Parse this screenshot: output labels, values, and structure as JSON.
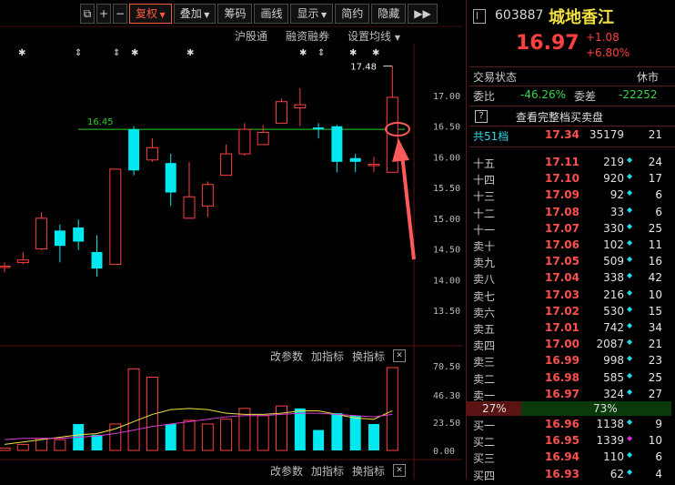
{
  "toolbar": {
    "buttons": [
      {
        "label": "⧉",
        "active": false,
        "square": true,
        "name": "window-toggle-button"
      },
      {
        "label": "+",
        "active": false,
        "square": true,
        "name": "zoom-in-button"
      },
      {
        "label": "−",
        "active": false,
        "square": true,
        "name": "zoom-out-button"
      },
      {
        "label": "复权",
        "active": true,
        "arrow": true,
        "name": "adjust-dropdown"
      },
      {
        "label": "叠加",
        "active": false,
        "arrow": true,
        "name": "overlay-dropdown"
      },
      {
        "label": "筹码",
        "active": false,
        "name": "chips-button"
      },
      {
        "label": "画线",
        "active": false,
        "name": "draw-line-button"
      },
      {
        "label": "显示",
        "active": false,
        "arrow": true,
        "name": "display-dropdown"
      },
      {
        "label": "简约",
        "active": false,
        "name": "simple-button"
      },
      {
        "label": "隐藏",
        "active": false,
        "name": "hide-button"
      },
      {
        "label": "▶▶",
        "active": false,
        "name": "more-button"
      }
    ],
    "sub": {
      "hugutong": "沪股通",
      "rongzi": "融资融券",
      "settings": "设置均线"
    }
  },
  "price_chart": {
    "axis_labels": [
      "17.00",
      "16.50",
      "16.00",
      "15.50",
      "15.00",
      "14.50",
      "14.00",
      "13.50"
    ],
    "hline_value": 16.45,
    "hline_label": "16.45",
    "high_label": "17.48",
    "candles": [
      {
        "o": 14.22,
        "c": 14.22,
        "h": 14.28,
        "l": 14.12,
        "up": true
      },
      {
        "o": 14.28,
        "c": 14.32,
        "h": 14.45,
        "l": 14.25,
        "up": true
      },
      {
        "o": 14.5,
        "c": 15.0,
        "h": 15.1,
        "l": 14.48,
        "up": true
      },
      {
        "o": 14.8,
        "c": 14.55,
        "h": 14.9,
        "l": 14.28,
        "up": false
      },
      {
        "o": 14.85,
        "c": 14.62,
        "h": 14.98,
        "l": 14.48,
        "up": false
      },
      {
        "o": 14.45,
        "c": 14.18,
        "h": 14.72,
        "l": 14.05,
        "up": false
      },
      {
        "o": 14.25,
        "c": 15.8,
        "h": 15.8,
        "l": 14.25,
        "up": true
      },
      {
        "o": 16.45,
        "c": 15.78,
        "h": 16.5,
        "l": 15.7,
        "up": false
      },
      {
        "o": 15.95,
        "c": 16.15,
        "h": 16.3,
        "l": 15.92,
        "up": true
      },
      {
        "o": 15.9,
        "c": 15.42,
        "h": 16.05,
        "l": 15.2,
        "up": false
      },
      {
        "o": 15.0,
        "c": 15.35,
        "h": 15.92,
        "l": 15.0,
        "up": true
      },
      {
        "o": 15.2,
        "c": 15.55,
        "h": 15.6,
        "l": 15.02,
        "up": true
      },
      {
        "o": 15.7,
        "c": 16.05,
        "h": 16.2,
        "l": 15.7,
        "up": true
      },
      {
        "o": 16.05,
        "c": 16.45,
        "h": 16.55,
        "l": 16.02,
        "up": true
      },
      {
        "o": 16.2,
        "c": 16.4,
        "h": 16.52,
        "l": 16.2,
        "up": true
      },
      {
        "o": 16.55,
        "c": 16.9,
        "h": 16.95,
        "l": 16.55,
        "up": true
      },
      {
        "o": 16.8,
        "c": 16.85,
        "h": 17.12,
        "l": 16.5,
        "up": true
      },
      {
        "o": 16.48,
        "c": 16.45,
        "h": 16.55,
        "l": 16.3,
        "up": false
      },
      {
        "o": 16.5,
        "c": 15.92,
        "h": 16.52,
        "l": 15.75,
        "up": false
      },
      {
        "o": 15.98,
        "c": 15.92,
        "h": 16.05,
        "l": 15.75,
        "up": false
      },
      {
        "o": 15.88,
        "c": 15.88,
        "h": 16.0,
        "l": 15.75,
        "up": true
      },
      {
        "o": 15.75,
        "c": 16.97,
        "h": 17.48,
        "l": 15.75,
        "up": true
      }
    ]
  },
  "volume_chart": {
    "axis_labels": [
      "70.50",
      "46.30",
      "23.50",
      "0.00"
    ],
    "header": {
      "param": "改参数",
      "add": "加指标",
      "switch": "换指标",
      "close": "✕"
    },
    "bars": [
      {
        "v": 2,
        "up": true
      },
      {
        "v": 5,
        "up": true
      },
      {
        "v": 10,
        "up": true
      },
      {
        "v": 9,
        "up": true
      },
      {
        "v": 22,
        "up": false
      },
      {
        "v": 13,
        "up": false
      },
      {
        "v": 22,
        "up": true
      },
      {
        "v": 68,
        "up": true
      },
      {
        "v": 61,
        "up": true
      },
      {
        "v": 22,
        "up": false
      },
      {
        "v": 25,
        "up": true
      },
      {
        "v": 22,
        "up": true
      },
      {
        "v": 26,
        "up": true
      },
      {
        "v": 35,
        "up": true
      },
      {
        "v": 29,
        "up": true
      },
      {
        "v": 37,
        "up": true
      },
      {
        "v": 35,
        "up": false
      },
      {
        "v": 17,
        "up": false
      },
      {
        "v": 31,
        "up": false
      },
      {
        "v": 29,
        "up": false
      },
      {
        "v": 22,
        "up": false
      },
      {
        "v": 69,
        "up": true
      }
    ],
    "ma_yellow": [
      5,
      7,
      9,
      11,
      13,
      14,
      18,
      24,
      30,
      34,
      35,
      34,
      31,
      30,
      30,
      31,
      33,
      33,
      30,
      27,
      26,
      33
    ],
    "ma_magenta": [
      9,
      10,
      10,
      10,
      11,
      12,
      14,
      17,
      20,
      22,
      24,
      26,
      28,
      29,
      29,
      30,
      31,
      31,
      30,
      29,
      28,
      30
    ]
  },
  "bottom_bar": {
    "param": "改参数",
    "add": "加指标",
    "switch": "换指标",
    "close": "✕"
  },
  "quote": {
    "code": "603887",
    "name": "城地香江",
    "price": "16.97",
    "change": "+1.08",
    "change_pct": "+6.80%",
    "status_label": "交易状态",
    "status_value": "休市",
    "weibi_label": "委比",
    "weibi_value": "-46.26%",
    "weicha_label": "委差",
    "weicha_value": "-22252",
    "full_book": "查看完整档买卖盘",
    "q_icon": "?",
    "total": {
      "label": "共51档",
      "price": "17.34",
      "vol": "35179",
      "cnt": "21"
    },
    "sells": [
      {
        "label": "十五",
        "price": "17.11",
        "vol": "219",
        "cnt": "24",
        "dot": true
      },
      {
        "label": "十四",
        "price": "17.10",
        "vol": "920",
        "cnt": "17",
        "dot": true
      },
      {
        "label": "十三",
        "price": "17.09",
        "vol": "92",
        "cnt": "6",
        "dot": true
      },
      {
        "label": "十二",
        "price": "17.08",
        "vol": "33",
        "cnt": "6",
        "dot": true
      },
      {
        "label": "十一",
        "price": "17.07",
        "vol": "330",
        "cnt": "25",
        "dot": true
      },
      {
        "label": "卖十",
        "price": "17.06",
        "vol": "102",
        "cnt": "11",
        "dot": true
      },
      {
        "label": "卖九",
        "price": "17.05",
        "vol": "509",
        "cnt": "16",
        "dot": true
      },
      {
        "label": "卖八",
        "price": "17.04",
        "vol": "338",
        "cnt": "42",
        "dot": true
      },
      {
        "label": "卖七",
        "price": "17.03",
        "vol": "216",
        "cnt": "10",
        "dot": true
      },
      {
        "label": "卖六",
        "price": "17.02",
        "vol": "530",
        "cnt": "15",
        "dot": true
      },
      {
        "label": "卖五",
        "price": "17.01",
        "vol": "742",
        "cnt": "34",
        "dot": true
      },
      {
        "label": "卖四",
        "price": "17.00",
        "vol": "2087",
        "cnt": "21",
        "dot": true
      },
      {
        "label": "卖三",
        "price": "16.99",
        "vol": "998",
        "cnt": "23",
        "dot": true
      },
      {
        "label": "卖二",
        "price": "16.98",
        "vol": "585",
        "cnt": "25",
        "dot": true
      },
      {
        "label": "卖一",
        "price": "16.97",
        "vol": "324",
        "cnt": "27",
        "dot": true
      }
    ],
    "ratio": {
      "left": "27%",
      "right": "73%",
      "left_frac": 0.27
    },
    "buys": [
      {
        "label": "买一",
        "price": "16.96",
        "vol": "1138",
        "cnt": "9",
        "dot": true,
        "dotcolor": "#26d9e8"
      },
      {
        "label": "买二",
        "price": "16.95",
        "vol": "1339",
        "cnt": "10",
        "dot": true,
        "dotcolor": "#d82ad8"
      },
      {
        "label": "买三",
        "price": "16.94",
        "vol": "110",
        "cnt": "6",
        "dot": true,
        "dotcolor": "#26d9e8"
      },
      {
        "label": "买四",
        "price": "16.93",
        "vol": "62",
        "cnt": "4",
        "dot": true,
        "dotcolor": "#26d9e8"
      }
    ]
  },
  "colors": {
    "up": "#ff4040",
    "down": "#00e8f0",
    "hline": "#28d028",
    "accent": "#ff5a3c",
    "yellow": "#f0e040",
    "magenta": "#d83ad8"
  }
}
